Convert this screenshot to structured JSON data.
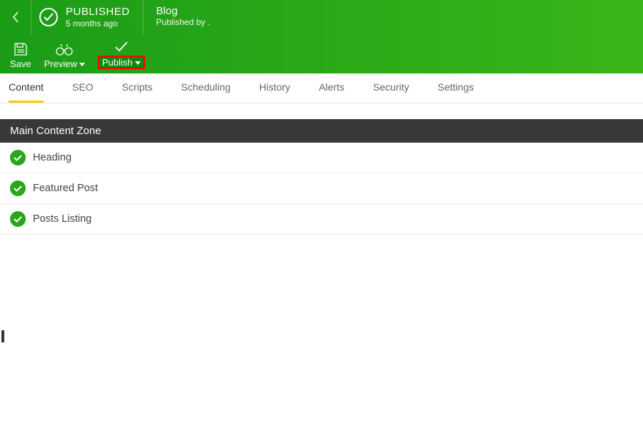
{
  "header": {
    "status_title": "PUBLISHED",
    "status_time": "5 months ago",
    "page_title": "Blog",
    "page_subtitle": "Published by ."
  },
  "toolbar": {
    "save": "Save",
    "preview": "Preview",
    "publish": "Publish"
  },
  "tabs": [
    "Content",
    "SEO",
    "Scripts",
    "Scheduling",
    "History",
    "Alerts",
    "Security",
    "Settings"
  ],
  "active_tab": "Content",
  "section_title": "Main Content Zone",
  "content_rows": [
    "Heading",
    "Featured Post",
    "Posts Listing"
  ]
}
